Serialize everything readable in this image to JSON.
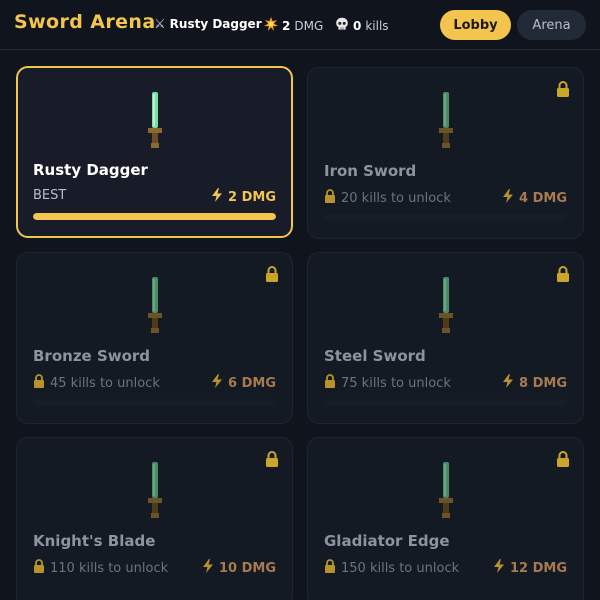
{
  "header": {
    "title": "Sword Arena",
    "equipped_icon": "crossed-swords-icon",
    "equipped_weapon": "Rusty Dagger",
    "damage_icon": "explosion-icon",
    "damage_value": "2",
    "damage_unit": "DMG",
    "kills_icon": "skull-icon",
    "kills_value": "0",
    "kills_unit": "kills",
    "lobby_label": "Lobby",
    "arena_label": "Arena"
  },
  "colors": {
    "accent": "#f3c44e",
    "background": "#10141c",
    "card": "#141a24",
    "locked_damage": "#a87b4f"
  },
  "weapons": [
    {
      "name": "Rusty Dagger",
      "requirement": "BEST",
      "damage": "2 DMG",
      "locked": false,
      "selected": true,
      "progress": 1.0
    },
    {
      "name": "Iron Sword",
      "requirement": "20 kills to unlock",
      "damage": "4 DMG",
      "locked": true,
      "selected": false,
      "progress": 0
    },
    {
      "name": "Bronze Sword",
      "requirement": "45 kills to unlock",
      "damage": "6 DMG",
      "locked": true,
      "selected": false,
      "progress": 0
    },
    {
      "name": "Steel Sword",
      "requirement": "75 kills to unlock",
      "damage": "8 DMG",
      "locked": true,
      "selected": false,
      "progress": 0
    },
    {
      "name": "Knight's Blade",
      "requirement": "110 kills to unlock",
      "damage": "10 DMG",
      "locked": true,
      "selected": false,
      "progress": 0
    },
    {
      "name": "Gladiator Edge",
      "requirement": "150 kills to unlock",
      "damage": "12 DMG",
      "locked": true,
      "selected": false,
      "progress": 0
    }
  ]
}
